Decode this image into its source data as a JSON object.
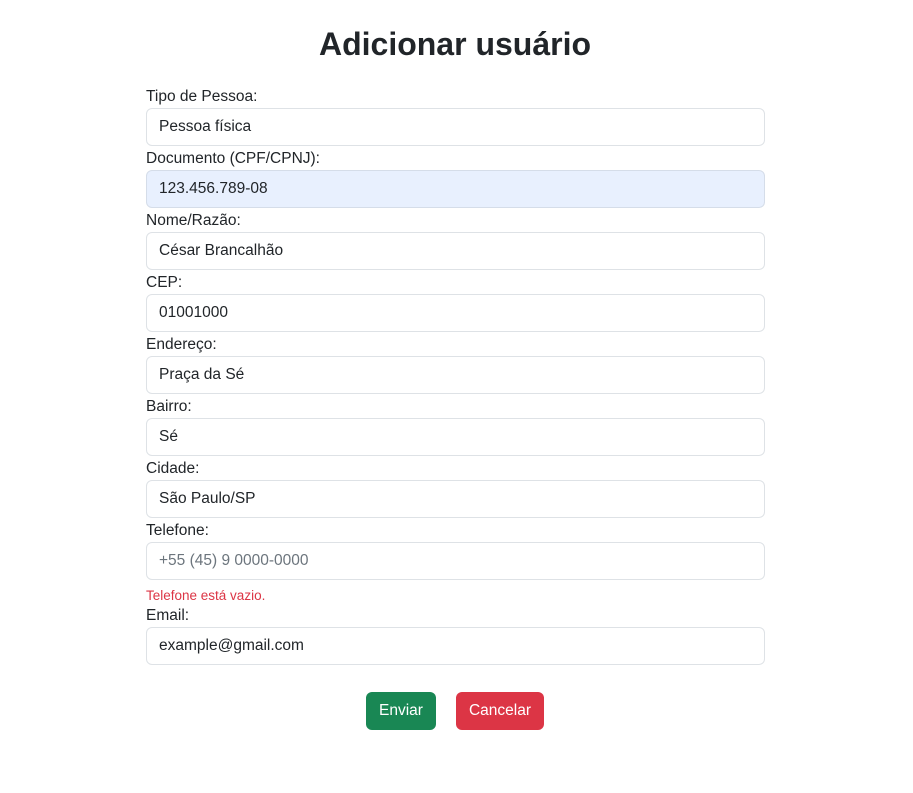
{
  "form": {
    "title": "Adicionar usuário",
    "fields": {
      "tipo_pessoa": {
        "label": "Tipo de Pessoa:",
        "value": "Pessoa física"
      },
      "documento": {
        "label": "Documento (CPF/CPNJ):",
        "value": "123.456.789-08"
      },
      "nome": {
        "label": "Nome/Razão:",
        "value": "César Brancalhão"
      },
      "cep": {
        "label": "CEP:",
        "value": "01001000"
      },
      "endereco": {
        "label": "Endereço:",
        "value": "Praça da Sé"
      },
      "bairro": {
        "label": "Bairro:",
        "value": "Sé"
      },
      "cidade": {
        "label": "Cidade:",
        "value": "São Paulo/SP"
      },
      "telefone": {
        "label": "Telefone:",
        "value": "",
        "placeholder": "+55 (45) 9 0000-0000",
        "error": "Telefone está vazio."
      },
      "email": {
        "label": "Email:",
        "value": "example@gmail.com"
      }
    },
    "buttons": {
      "submit": "Enviar",
      "cancel": "Cancelar"
    },
    "colors": {
      "submit_bg": "#198754",
      "cancel_bg": "#dc3545",
      "error_text": "#dc3545",
      "autofill_bg": "#e8f0fe"
    }
  }
}
